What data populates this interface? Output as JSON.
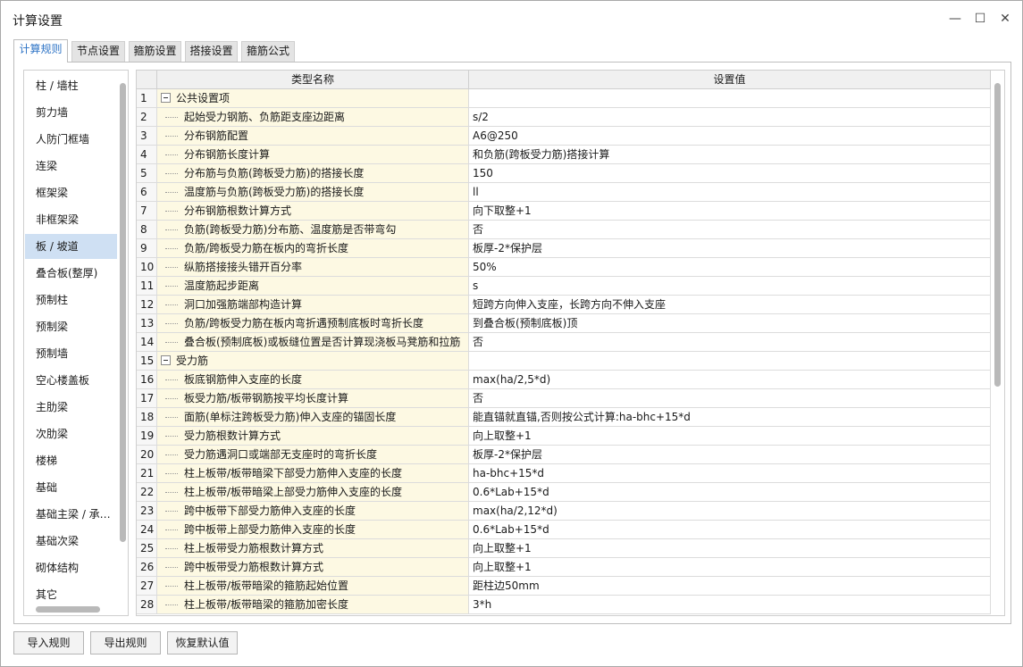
{
  "window": {
    "title": "计算设置",
    "minimize": "—",
    "maximize": "☐",
    "close": "✕"
  },
  "tabs": [
    {
      "label": "计算规则",
      "active": true
    },
    {
      "label": "节点设置",
      "active": false
    },
    {
      "label": "箍筋设置",
      "active": false
    },
    {
      "label": "搭接设置",
      "active": false
    },
    {
      "label": "箍筋公式",
      "active": false
    }
  ],
  "sidebar": {
    "items": [
      "柱 / 墙柱",
      "剪力墙",
      "人防门框墙",
      "连梁",
      "框架梁",
      "非框架梁",
      "板 / 坡道",
      "叠合板(整厚)",
      "预制柱",
      "预制梁",
      "预制墙",
      "空心楼盖板",
      "主肋梁",
      "次肋梁",
      "楼梯",
      "基础",
      "基础主梁 / 承…",
      "基础次梁",
      "砌体结构",
      "其它"
    ],
    "selected_index": 6
  },
  "grid": {
    "headers": {
      "name": "类型名称",
      "value": "设置值"
    },
    "rows": [
      {
        "num": "1",
        "name": "公共设置项",
        "value": "",
        "group": true
      },
      {
        "num": "2",
        "name": "起始受力钢筋、负筋距支座边距离",
        "value": "s/2"
      },
      {
        "num": "3",
        "name": "分布钢筋配置",
        "value": "A6@250"
      },
      {
        "num": "4",
        "name": "分布钢筋长度计算",
        "value": "和负筋(跨板受力筋)搭接计算"
      },
      {
        "num": "5",
        "name": "分布筋与负筋(跨板受力筋)的搭接长度",
        "value": "150"
      },
      {
        "num": "6",
        "name": "温度筋与负筋(跨板受力筋)的搭接长度",
        "value": "ll"
      },
      {
        "num": "7",
        "name": "分布钢筋根数计算方式",
        "value": "向下取整+1"
      },
      {
        "num": "8",
        "name": "负筋(跨板受力筋)分布筋、温度筋是否带弯勾",
        "value": "否"
      },
      {
        "num": "9",
        "name": "负筋/跨板受力筋在板内的弯折长度",
        "value": "板厚-2*保护层"
      },
      {
        "num": "10",
        "name": "纵筋搭接接头错开百分率",
        "value": "50%"
      },
      {
        "num": "11",
        "name": "温度筋起步距离",
        "value": "s"
      },
      {
        "num": "12",
        "name": "洞口加强筋端部构造计算",
        "value": "短跨方向伸入支座，长跨方向不伸入支座"
      },
      {
        "num": "13",
        "name": "负筋/跨板受力筋在板内弯折遇预制底板时弯折长度",
        "value": "到叠合板(预制底板)顶"
      },
      {
        "num": "14",
        "name": "叠合板(预制底板)或板缝位置是否计算现浇板马凳筋和拉筋",
        "value": "否"
      },
      {
        "num": "15",
        "name": "受力筋",
        "value": "",
        "group": true
      },
      {
        "num": "16",
        "name": "板底钢筋伸入支座的长度",
        "value": "max(ha/2,5*d)"
      },
      {
        "num": "17",
        "name": "板受力筋/板带钢筋按平均长度计算",
        "value": "否"
      },
      {
        "num": "18",
        "name": "面筋(单标注跨板受力筋)伸入支座的锚固长度",
        "value": "能直锚就直锚,否则按公式计算:ha-bhc+15*d"
      },
      {
        "num": "19",
        "name": "受力筋根数计算方式",
        "value": "向上取整+1"
      },
      {
        "num": "20",
        "name": "受力筋遇洞口或端部无支座时的弯折长度",
        "value": "板厚-2*保护层"
      },
      {
        "num": "21",
        "name": "柱上板带/板带暗梁下部受力筋伸入支座的长度",
        "value": "ha-bhc+15*d"
      },
      {
        "num": "22",
        "name": "柱上板带/板带暗梁上部受力筋伸入支座的长度",
        "value": "0.6*Lab+15*d"
      },
      {
        "num": "23",
        "name": "跨中板带下部受力筋伸入支座的长度",
        "value": "max(ha/2,12*d)"
      },
      {
        "num": "24",
        "name": "跨中板带上部受力筋伸入支座的长度",
        "value": "0.6*Lab+15*d"
      },
      {
        "num": "25",
        "name": "柱上板带受力筋根数计算方式",
        "value": "向上取整+1"
      },
      {
        "num": "26",
        "name": "跨中板带受力筋根数计算方式",
        "value": "向上取整+1"
      },
      {
        "num": "27",
        "name": "柱上板带/板带暗梁的箍筋起始位置",
        "value": "距柱边50mm"
      },
      {
        "num": "28",
        "name": "柱上板带/板带暗梁的箍筋加密长度",
        "value": "3*h"
      }
    ]
  },
  "footer": {
    "import_label": "导入规则",
    "export_label": "导出规则",
    "reset_label": "恢复默认值"
  }
}
